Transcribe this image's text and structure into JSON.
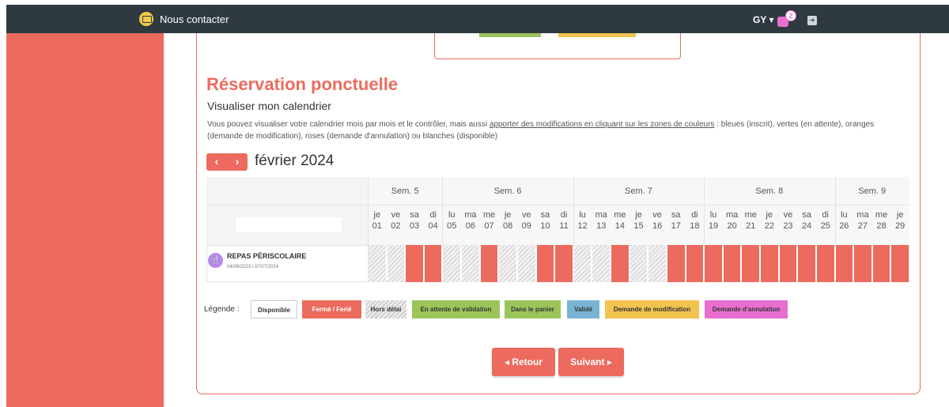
{
  "topbar": {
    "contact_label": "Nous contacter",
    "user_initials": "GY ▾",
    "cart_count": "2"
  },
  "page": {
    "title": "Réservation ponctuelle",
    "subtitle": "Visualiser mon calendrier",
    "desc_prefix": "Vous pouvez visualiser votre calendrier mois par mois et le contrôler, mais aussi ",
    "desc_link": "apporter des modifications en cliquant sur les zones de couleurs",
    "desc_suffix": " : bleues (inscrit), vertes (en attente), oranges (demande de modification), roses (demande d'annulation) ou blanches (disponible)"
  },
  "calendar": {
    "prev": "‹",
    "next": "›",
    "month": "février 2024",
    "weeks": [
      "Sem. 5",
      "Sem. 6",
      "Sem. 7",
      "Sem. 8",
      "Sem. 9"
    ],
    "days": [
      {
        "d": "je",
        "n": "01",
        "s": "late"
      },
      {
        "d": "ve",
        "n": "02",
        "s": "late"
      },
      {
        "d": "sa",
        "n": "03",
        "s": "closed"
      },
      {
        "d": "di",
        "n": "04",
        "s": "closed"
      },
      {
        "d": "lu",
        "n": "05",
        "s": "late"
      },
      {
        "d": "ma",
        "n": "06",
        "s": "late"
      },
      {
        "d": "me",
        "n": "07",
        "s": "closed"
      },
      {
        "d": "je",
        "n": "08",
        "s": "late"
      },
      {
        "d": "ve",
        "n": "09",
        "s": "late"
      },
      {
        "d": "sa",
        "n": "10",
        "s": "closed"
      },
      {
        "d": "di",
        "n": "11",
        "s": "closed"
      },
      {
        "d": "lu",
        "n": "12",
        "s": "late"
      },
      {
        "d": "ma",
        "n": "13",
        "s": "late"
      },
      {
        "d": "me",
        "n": "14",
        "s": "closed"
      },
      {
        "d": "je",
        "n": "15",
        "s": "late"
      },
      {
        "d": "ve",
        "n": "16",
        "s": "late"
      },
      {
        "d": "sa",
        "n": "17",
        "s": "closed"
      },
      {
        "d": "di",
        "n": "18",
        "s": "closed"
      },
      {
        "d": "lu",
        "n": "19",
        "s": "closed"
      },
      {
        "d": "ma",
        "n": "20",
        "s": "closed"
      },
      {
        "d": "me",
        "n": "21",
        "s": "closed"
      },
      {
        "d": "je",
        "n": "22",
        "s": "closed"
      },
      {
        "d": "ve",
        "n": "23",
        "s": "closed"
      },
      {
        "d": "sa",
        "n": "24",
        "s": "closed"
      },
      {
        "d": "di",
        "n": "25",
        "s": "closed"
      },
      {
        "d": "lu",
        "n": "26",
        "s": "closed"
      },
      {
        "d": "ma",
        "n": "27",
        "s": "closed"
      },
      {
        "d": "me",
        "n": "28",
        "s": "closed"
      },
      {
        "d": "je",
        "n": "29",
        "s": "closed"
      }
    ],
    "activity": {
      "name": "REPAS PÉRISCOLAIRE",
      "dates": "04/09/2023 / 07/07/2024",
      "icon": "fork-knife-icon"
    }
  },
  "legend": {
    "label": "Légende :",
    "items": [
      "Disponible",
      "Fermé / Ferié",
      "Hors délai",
      "En attente de validation",
      "Dans le panier",
      "Validé",
      "Demande de modification",
      "Demande d'annulation"
    ]
  },
  "buttons": {
    "back": "◂ Retour",
    "next": "Suivant ▸"
  },
  "colors": {
    "accent": "#ec6b5e",
    "topbar": "#2e3a40",
    "green": "#9bc55a",
    "blue": "#79b4d4",
    "orange": "#f3c34f",
    "pink": "#e86fd0"
  }
}
